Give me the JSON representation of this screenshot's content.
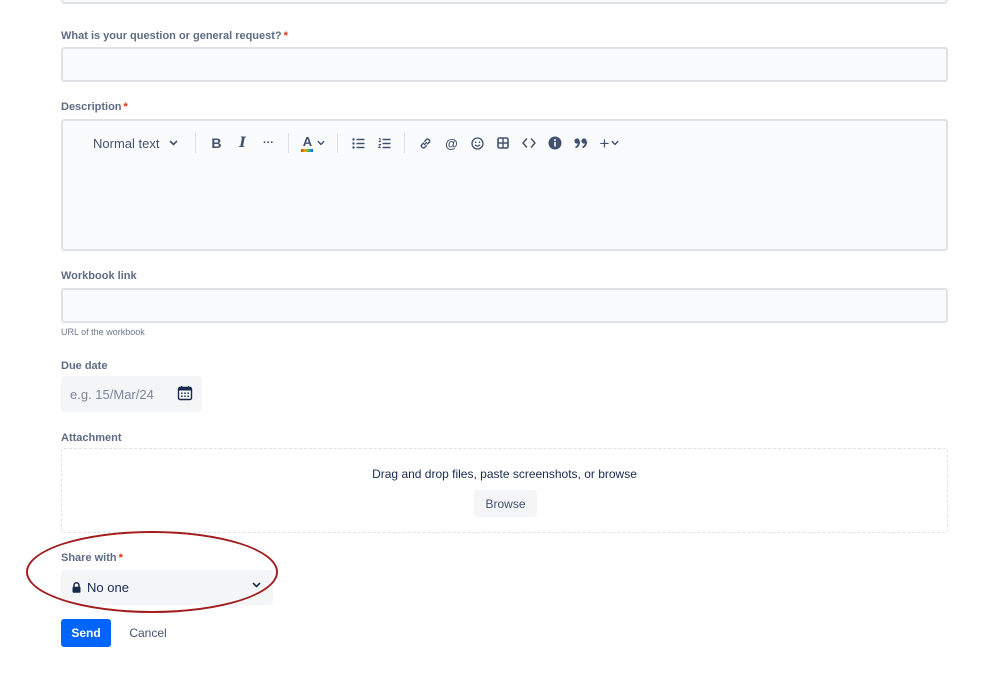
{
  "question": {
    "label": "What is your question or general request?",
    "required_mark": "*",
    "value": ""
  },
  "description": {
    "label": "Description",
    "required_mark": "*",
    "toolbar": {
      "text_style": "Normal text",
      "bold": "B",
      "italic": "I",
      "more": "···",
      "text_color": "A",
      "mention": "@",
      "quote": "99",
      "insert": "+"
    },
    "value": ""
  },
  "workbook": {
    "label": "Workbook link",
    "helper": "URL of the workbook",
    "value": ""
  },
  "due_date": {
    "label": "Due date",
    "placeholder": "e.g. 15/Mar/24"
  },
  "attachment": {
    "label": "Attachment",
    "drop_text": "Drag and drop files, paste screenshots, or browse",
    "browse_label": "Browse"
  },
  "share": {
    "label": "Share with",
    "required_mark": "*",
    "selected": "No one"
  },
  "actions": {
    "send_label": "Send",
    "cancel_label": "Cancel"
  },
  "colors": {
    "primary": "#0065ff",
    "required": "#de350b",
    "annotation": "#a11d1d"
  }
}
